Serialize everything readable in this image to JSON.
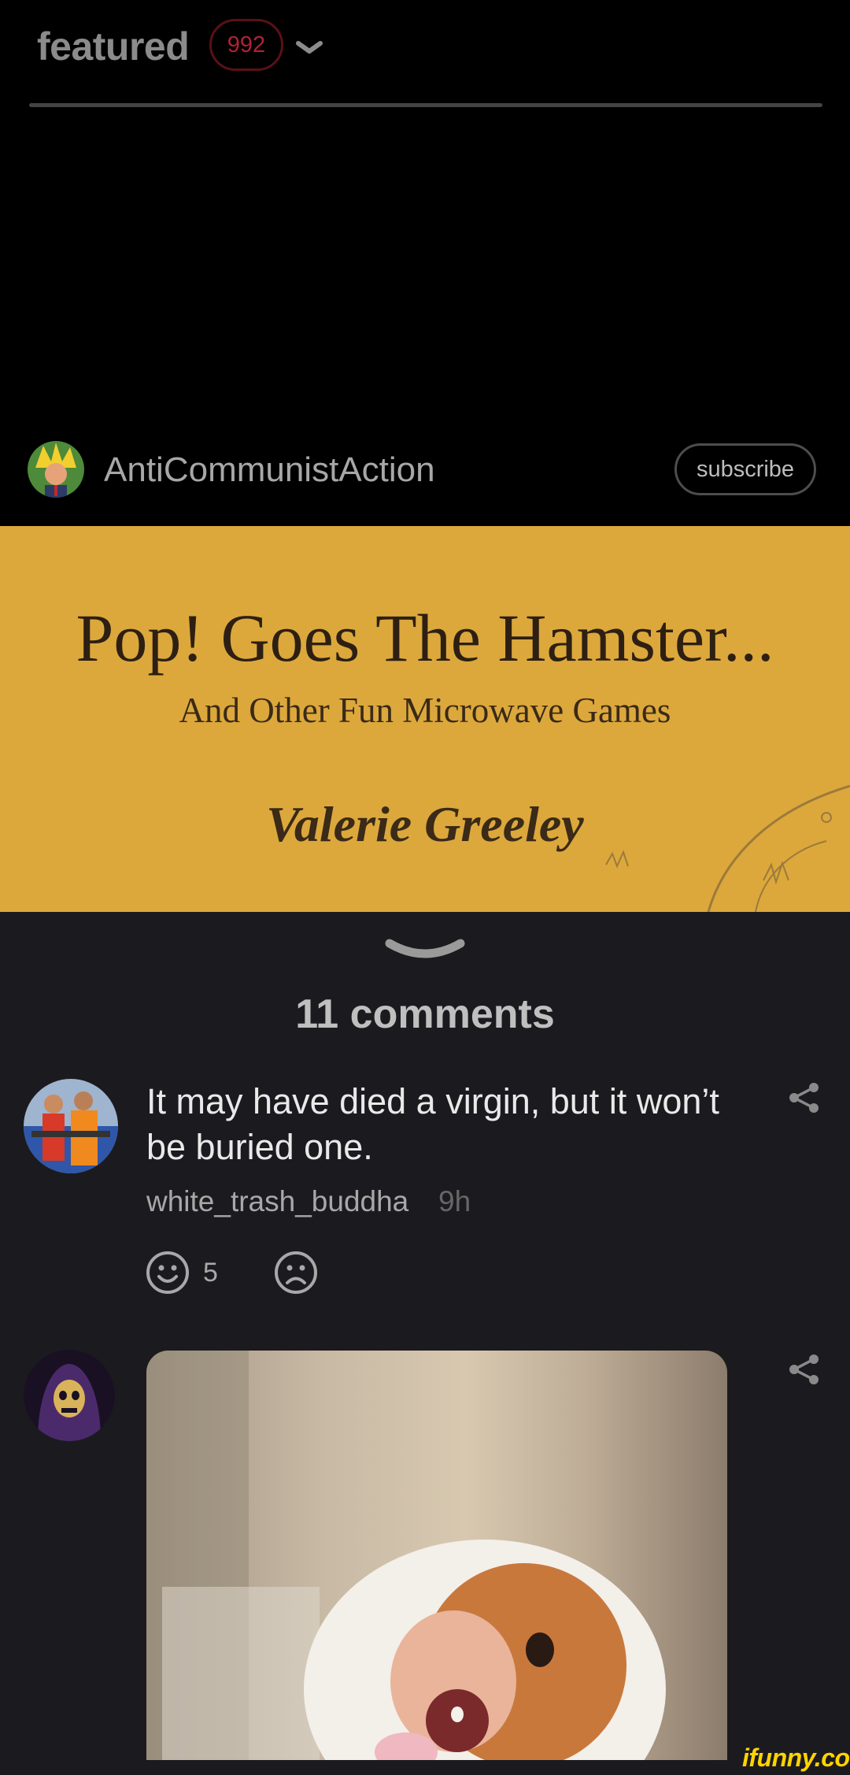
{
  "header": {
    "title": "featured",
    "count": "992"
  },
  "post": {
    "author": "AntiCommunistAction",
    "subscribe_label": "subscribe",
    "image": {
      "title": "Pop! Goes The Hamster...",
      "subtitle": "And Other Fun Microwave Games",
      "author": "Valerie Greeley"
    }
  },
  "comments": {
    "count_label": "11 comments",
    "items": [
      {
        "text": "It may have died a virgin, but it won’t be buried one.",
        "user": "white_trash_buddha",
        "time": "9h",
        "smiles": "5"
      },
      {
        "type": "image"
      }
    ]
  },
  "watermark": "ifunny.co",
  "colors": {
    "background": "#000000",
    "panel": "#1b1b1f",
    "badge": "#b02231",
    "meme_bg": "#dca83c",
    "watermark": "#ffd400"
  },
  "icons": [
    "chevron-down-icon",
    "share-icon",
    "smile-icon",
    "frown-icon"
  ]
}
